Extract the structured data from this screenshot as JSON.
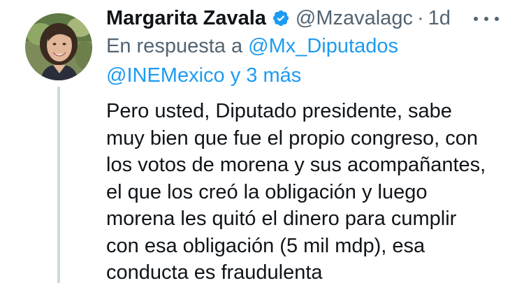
{
  "author": {
    "name": "Margarita Zavala",
    "handle": "@Mzavalagc",
    "separator": "·",
    "time": "1d",
    "verified": true,
    "avatar_icon": "profile-photo"
  },
  "reply_context": {
    "prefix": "En respuesta a",
    "mention_1": "@Mx_Diputados",
    "mention_2": "@INEMexico",
    "suffix": "y 3 más"
  },
  "tweet": {
    "lines": [
      "Pero usted, Diputado presidente, sabe",
      "muy bien que fue el propio congreso, con",
      "los votos de morena y sus acompañantes,",
      "el que los creó la obligación y luego",
      "morena les quitó el dinero para cumplir",
      "con esa obligación (5 mil mdp), esa",
      "conducta es fraudulenta"
    ]
  },
  "colors": {
    "text": "#0f1419",
    "secondary": "#536471",
    "accent": "#1d9bf0",
    "thread": "#cfd9de"
  },
  "icons": {
    "verified": "verified-badge-icon",
    "more": "more-options-icon"
  }
}
